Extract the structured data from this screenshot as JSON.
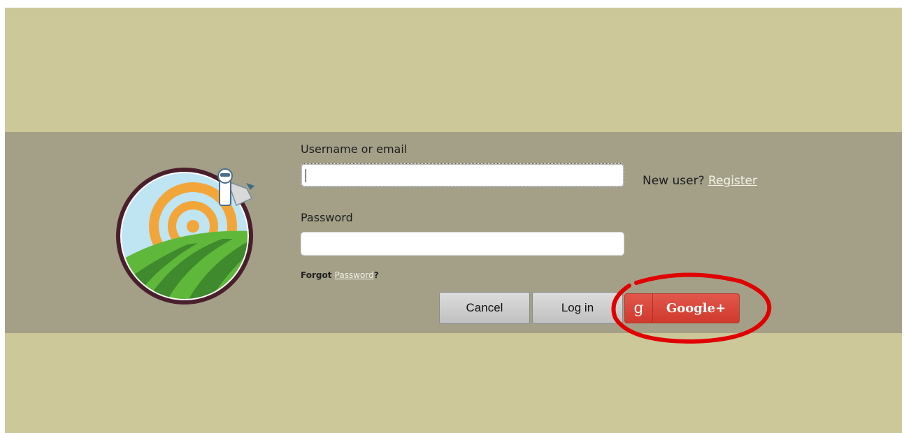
{
  "form": {
    "username_label": "Username or email",
    "username_value": "",
    "password_label": "Password",
    "password_value": "",
    "new_user_text": "New user?",
    "register_link": "Register",
    "forgot_text": "Forgot",
    "forgot_link": "Password",
    "forgot_suffix": "?"
  },
  "buttons": {
    "cancel": "Cancel",
    "login": "Log in",
    "google_icon": "g",
    "google_label": "Google+"
  },
  "colors": {
    "background": "#ccc89a",
    "band": "#a4a088",
    "google_red": "#d64537",
    "annotation": "#e00000"
  },
  "icons": {
    "logo": "farm-field-logo",
    "annotation": "red-circle-annotation"
  }
}
